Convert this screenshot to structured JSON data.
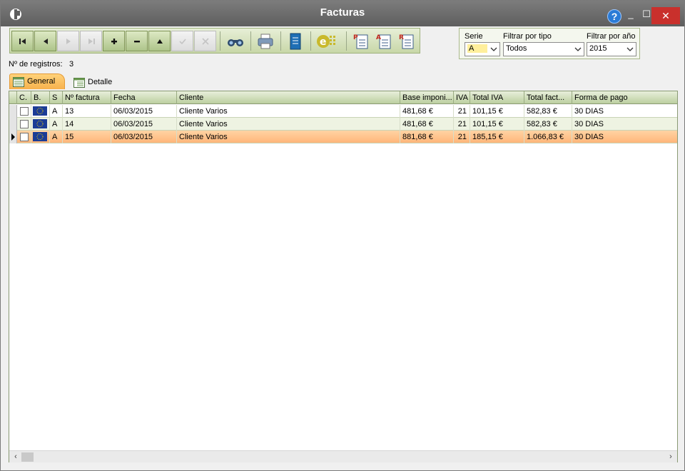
{
  "window": {
    "title": "Facturas"
  },
  "titlebar": {
    "help": "?",
    "minimize": "_",
    "maximize": "☐",
    "close": "✕"
  },
  "filters": {
    "serie": {
      "label": "Serie",
      "value": "A"
    },
    "tipo": {
      "label": "Filtrar por tipo",
      "value": "Todos"
    },
    "anio": {
      "label": "Filtrar por año",
      "value": "2015"
    }
  },
  "records": {
    "label": "Nº de registros:",
    "count": "3"
  },
  "tabs": [
    {
      "label": "General",
      "active": true
    },
    {
      "label": "Detalle",
      "active": false
    }
  ],
  "grid": {
    "columns": [
      "C.",
      "B.",
      "S",
      "Nº factura",
      "Fecha",
      "Cliente",
      "Base imponi...",
      "IVA",
      "Total IVA",
      "Total fact...",
      "Forma de pago"
    ],
    "rows": [
      {
        "serie": "A",
        "numero": "13",
        "fecha": "06/03/2015",
        "cliente": "Cliente Varios",
        "base": "481,68 €",
        "iva": "21",
        "total_iva": "101,15 €",
        "total": "582,83 €",
        "pago": "30 DIAS"
      },
      {
        "serie": "A",
        "numero": "14",
        "fecha": "06/03/2015",
        "cliente": "Cliente Varios",
        "base": "481,68 €",
        "iva": "21",
        "total_iva": "101,15 €",
        "total": "582,83 €",
        "pago": "30 DIAS"
      },
      {
        "serie": "A",
        "numero": "15",
        "fecha": "06/03/2015",
        "cliente": "Cliente Varios",
        "base": "881,68 €",
        "iva": "21",
        "total_iva": "185,15 €",
        "total": "1.066,83 €",
        "pago": "30 DIAS"
      }
    ],
    "selected_row": 2
  },
  "scrollbar": {
    "left": "‹",
    "right": "›"
  },
  "colors": {
    "titlebar": "#6d6d6d",
    "toolbar": "#c8d7a8",
    "selected_row": "#ffc48f",
    "alt_row": "#eef3e2",
    "active_tab": "#f7b14c"
  },
  "icons": {
    "toolbar": [
      "first-record-icon",
      "previous-record-icon",
      "next-record-icon",
      "last-record-icon",
      "add-icon",
      "delete-icon",
      "edit-up-icon",
      "confirm-icon",
      "cancel-icon",
      "binoculars-search-icon",
      "print-icon",
      "document-icon",
      "e-invoice-icon",
      "pdf-icon",
      "pdf-a-icon",
      "pdf-r-icon"
    ]
  }
}
